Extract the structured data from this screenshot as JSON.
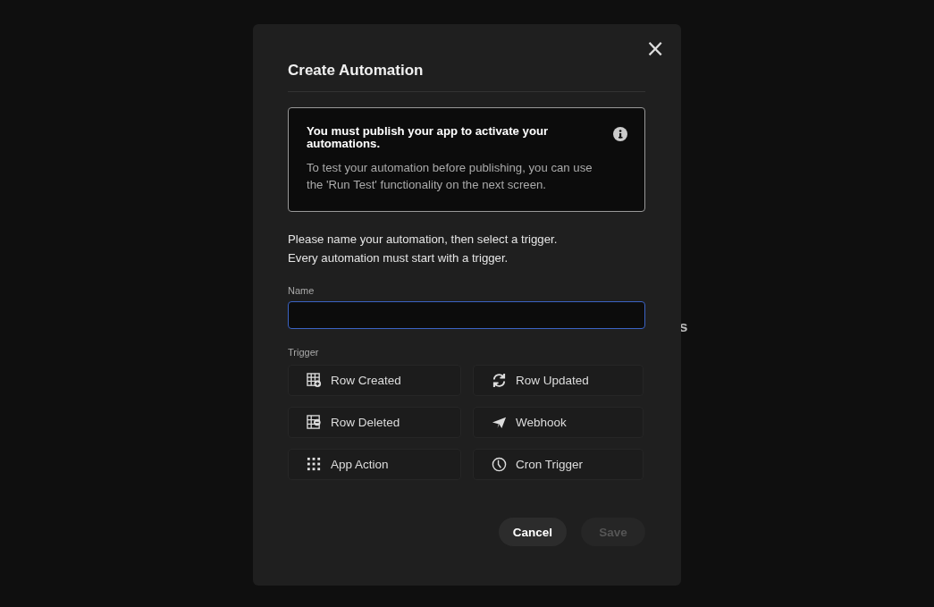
{
  "background_text": "s",
  "dialog": {
    "title": "Create Automation",
    "close": "×",
    "notice": {
      "heading": "You must publish your app to activate your automations.",
      "body": "To test your automation before publishing, you can use the 'Run Test' functionality on the next screen."
    },
    "intro": [
      "Please name your automation, then select a trigger.",
      "Every automation must start with a trigger."
    ],
    "name_field": {
      "label": "Name",
      "focused": true
    },
    "trigger_label": "Trigger",
    "triggers": [
      {
        "label": "Row Created",
        "kind": "created",
        "selected": false
      },
      {
        "label": "Row Updated",
        "kind": "updated",
        "selected": false
      },
      {
        "label": "Row Deleted",
        "kind": "deleted",
        "selected": false
      },
      {
        "label": "Webhook",
        "kind": "webhook",
        "selected": false
      },
      {
        "label": "App Action",
        "kind": "action",
        "selected": false
      },
      {
        "label": "Cron Trigger",
        "kind": "cron",
        "selected": false
      }
    ],
    "buttons": [
      {
        "label": "Cancel",
        "disabled": false
      },
      {
        "label": "Save",
        "disabled": true
      }
    ]
  }
}
